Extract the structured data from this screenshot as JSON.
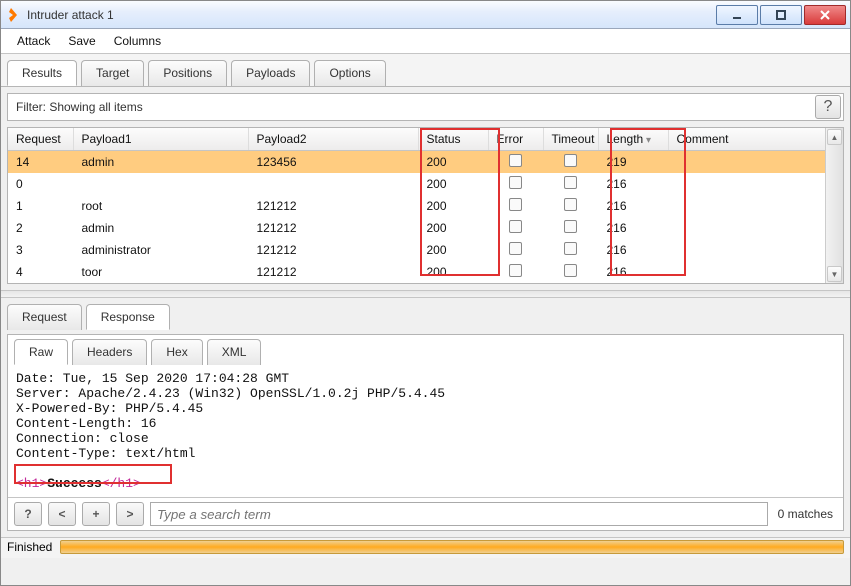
{
  "window": {
    "title": "Intruder attack 1"
  },
  "menu": {
    "attack": "Attack",
    "save": "Save",
    "columns": "Columns"
  },
  "main_tabs": {
    "results": "Results",
    "target": "Target",
    "positions": "Positions",
    "payloads": "Payloads",
    "options": "Options"
  },
  "filter": {
    "text": "Filter: Showing all items"
  },
  "table": {
    "headers": {
      "request": "Request",
      "payload1": "Payload1",
      "payload2": "Payload2",
      "status": "Status",
      "error": "Error",
      "timeout": "Timeout",
      "length": "Length",
      "comment": "Comment"
    },
    "rows": [
      {
        "request": "14",
        "payload1": "admin",
        "payload2": "123456",
        "status": "200",
        "length": "219"
      },
      {
        "request": "0",
        "payload1": "",
        "payload2": "",
        "status": "200",
        "length": "216"
      },
      {
        "request": "1",
        "payload1": "root",
        "payload2": "121212",
        "status": "200",
        "length": "216"
      },
      {
        "request": "2",
        "payload1": "admin",
        "payload2": "121212",
        "status": "200",
        "length": "216"
      },
      {
        "request": "3",
        "payload1": "administrator",
        "payload2": "121212",
        "status": "200",
        "length": "216"
      },
      {
        "request": "4",
        "payload1": "toor",
        "payload2": "121212",
        "status": "200",
        "length": "216"
      }
    ]
  },
  "detail_tabs": {
    "request": "Request",
    "response": "Response"
  },
  "resp_tabs": {
    "raw": "Raw",
    "headers": "Headers",
    "hex": "Hex",
    "xml": "XML"
  },
  "response": {
    "line1": "Date: Tue, 15 Sep 2020 17:04:28 GMT",
    "line2": "Server: Apache/2.4.23 (Win32) OpenSSL/1.0.2j PHP/5.4.45",
    "line3": "X-Powered-By: PHP/5.4.45",
    "line4": "Content-Length: 16",
    "line5": "Connection: close",
    "line6": "Content-Type: text/html",
    "body_open": "<h1>",
    "body_text": "Success",
    "body_close": "</h1>"
  },
  "search": {
    "help": "?",
    "prev": "<",
    "plus": "+",
    "next": ">",
    "placeholder": "Type a search term",
    "matches": "0 matches"
  },
  "status": {
    "label": "Finished"
  }
}
